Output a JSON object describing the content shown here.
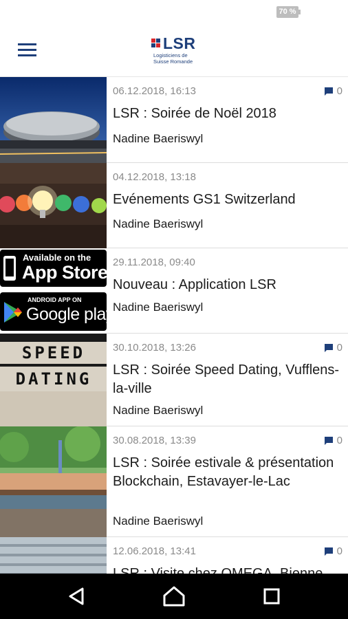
{
  "status_bar": {
    "battery": "70 %"
  },
  "header": {
    "logo_text": "LSR",
    "logo_sub_1": "Logisticiens de",
    "logo_sub_2": "Suisse Romande",
    "accent_color": "#1e3f7a"
  },
  "articles": [
    {
      "date": "06.12.2018, 16:13",
      "comments": "0",
      "title": "LSR : Soirée de Noël 2018",
      "author": "Nadine Baeriswyl",
      "image": "stadium-photo"
    },
    {
      "date": "04.12.2018, 13:18",
      "comments": "",
      "title": "Evénements GS1 Switzerland",
      "author": "Nadine Baeriswyl",
      "image": "lightbulb-paper-photo"
    },
    {
      "date": "29.11.2018, 09:40",
      "comments": "",
      "title": "Nouveau : Application LSR",
      "author": "Nadine Baeriswyl",
      "image": "app-store-badges",
      "badge_app_store_small": "Available on the",
      "badge_app_store_big": "App Store",
      "badge_google_small": "ANDROID APP ON",
      "badge_google_big": "Google play"
    },
    {
      "date": "30.10.2018, 13:26",
      "comments": "0",
      "title": "LSR : Soirée Speed Dating, Vufflens-la-ville",
      "author": "Nadine Baeriswyl",
      "image": "speed-dating-board",
      "board_line_1": "SPEED",
      "board_line_2": "DATING"
    },
    {
      "date": "30.08.2018, 13:39",
      "comments": "0",
      "title": "LSR : Soirée estivale & présentation Blockchain, Estavayer-le-Lac",
      "author": "Nadine Baeriswyl",
      "image": "lake-restaurant-photo"
    },
    {
      "date": "12.06.2018, 13:41",
      "comments": "0",
      "title": "LSR : Visite chez OMEGA, Bienne",
      "author": "",
      "image": "building-photo"
    }
  ],
  "nav": {
    "back": "back-icon",
    "home": "home-icon",
    "recents": "recents-icon"
  }
}
